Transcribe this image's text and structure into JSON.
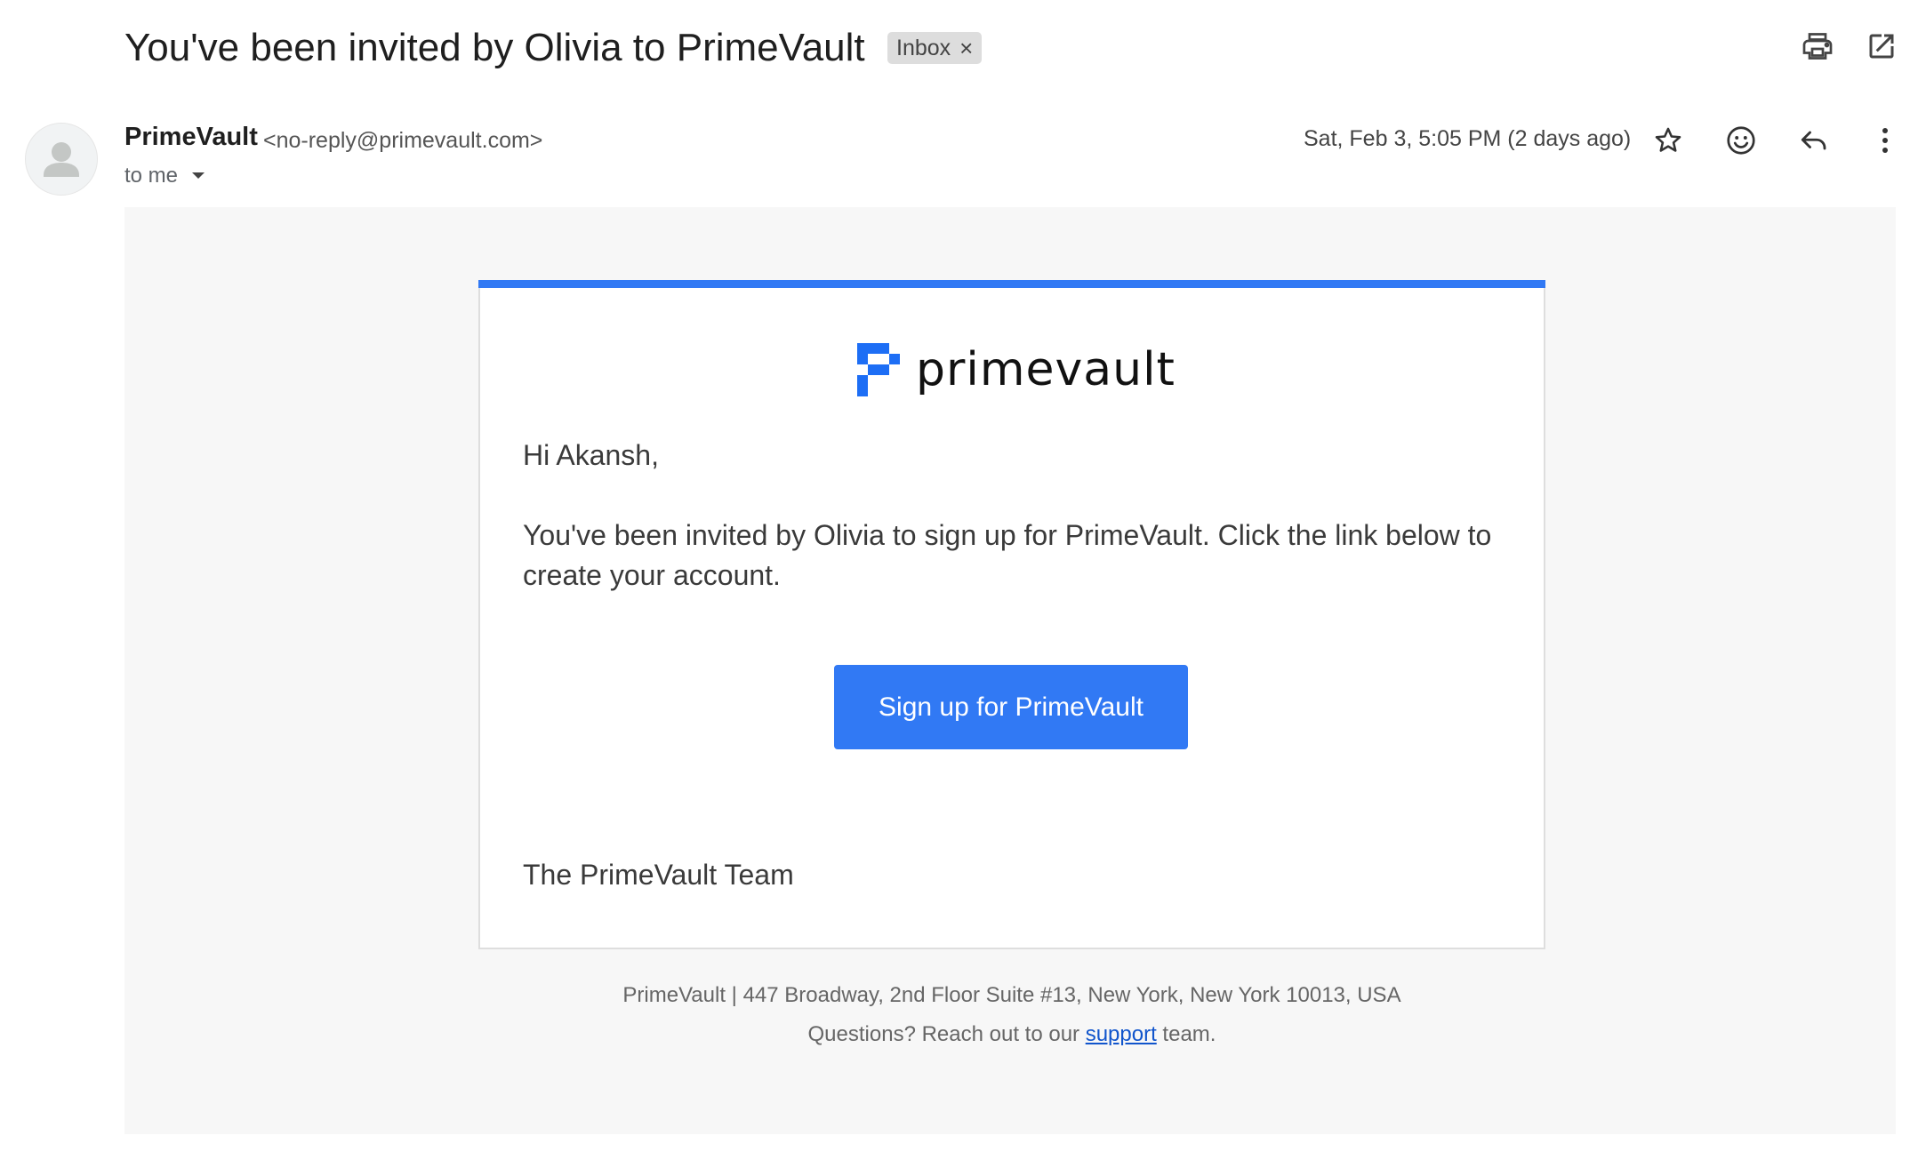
{
  "header": {
    "subject": "You've been invited by Olivia to PrimeVault",
    "label": "Inbox",
    "label_remove": "×"
  },
  "sender": {
    "name": "PrimeVault",
    "email": "<no-reply@primevault.com>",
    "recipient": "to me",
    "date": "Sat, Feb 3, 5:05 PM (2 days ago)"
  },
  "icons": {
    "print": "print-icon",
    "popout": "open-in-new-window-icon",
    "star": "star-icon",
    "emoji": "emoji-icon",
    "reply": "reply-icon",
    "more": "more-vertical-icon"
  },
  "email_body": {
    "logo_text": "primevault",
    "greeting": "Hi Akansh,",
    "message": "You've been invited by Olivia to sign up for PrimeVault. Click the link below to create your account.",
    "cta_label": "Sign up for PrimeVault",
    "signoff": "The PrimeVault Team"
  },
  "footer": {
    "address": "PrimeVault | 447 Broadway, 2nd Floor Suite #13, New York, New York 10013, USA",
    "question_prefix": "Questions? Reach out to our ",
    "support_link": "support",
    "question_suffix": " team."
  },
  "colors": {
    "accent": "#3179f4",
    "link": "#1155cc",
    "background": "#f7f7f7"
  }
}
